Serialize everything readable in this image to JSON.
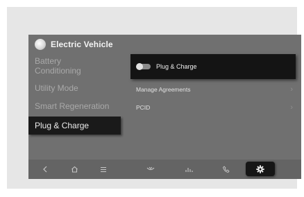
{
  "app": {
    "title": "Electric Vehicle",
    "icon": "ev-icon"
  },
  "menu": {
    "items": [
      {
        "label": "Battery Conditioning",
        "line1": "Battery",
        "line2": "Conditioning",
        "active": false
      },
      {
        "label": "Utility Mode",
        "active": false
      },
      {
        "label": "Smart Regeneration",
        "active": false
      },
      {
        "label": "Plug & Charge",
        "active": true
      }
    ]
  },
  "content": {
    "toggle": {
      "label": "Plug & Charge",
      "state": "off"
    },
    "rows": [
      {
        "label": "Manage Agreements",
        "icon": "chevron-right-icon"
      },
      {
        "label": "PCID",
        "icon": "chevron-right-icon"
      }
    ]
  },
  "bottom_nav": {
    "items": [
      {
        "icon": "back-icon",
        "glyph": "<"
      },
      {
        "icon": "home-icon",
        "glyph": "⌂"
      },
      {
        "icon": "menu-icon",
        "glyph": "≡"
      },
      {
        "icon": "hvac-icon",
        "glyph": "ᵕ"
      },
      {
        "icon": "media-icon",
        "glyph": "ılı"
      },
      {
        "icon": "phone-icon",
        "glyph": "✆"
      },
      {
        "icon": "settings-icon",
        "glyph": "⚙"
      }
    ],
    "active": "settings-icon"
  },
  "colors": {
    "screen_bg": "#707070",
    "selected_bg": "#1a1a1a",
    "inactive_text": "#a9a9a9",
    "active_text": "#ececec"
  }
}
